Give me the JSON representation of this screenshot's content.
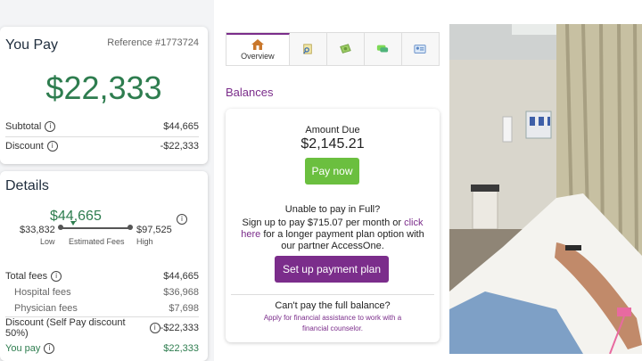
{
  "left": {
    "you_pay_title": "You Pay",
    "reference": "Reference #1773724",
    "amount": "$22,333",
    "subtotal_label": "Subtotal",
    "subtotal_value": "$44,665",
    "discount_label": "Discount",
    "discount_value": "-$22,333",
    "details_title": "Details",
    "estimate": {
      "center": "$44,665",
      "low_value": "$33,832",
      "high_value": "$97,525",
      "low_label": "Low",
      "mid_label": "Estimated Fees",
      "high_label": "High"
    },
    "fees": [
      {
        "label": "Total fees",
        "value": "$44,665"
      },
      {
        "label": "Hospital fees",
        "value": "$36,968"
      },
      {
        "label": "Physician fees",
        "value": "$7,698"
      },
      {
        "label": "Discount (Self Pay discount 50%)",
        "value": "-$22,333"
      },
      {
        "label": "You pay",
        "value": "$22,333"
      }
    ]
  },
  "tabs": [
    {
      "label": "Overview",
      "icon": "house-icon"
    },
    {
      "label": "",
      "icon": "document-icon"
    },
    {
      "label": "",
      "icon": "money-icon"
    },
    {
      "label": "",
      "icon": "chat-icon"
    },
    {
      "label": "",
      "icon": "id-card-icon"
    }
  ],
  "balances": {
    "heading": "Balances",
    "amount_due_label": "Amount Due",
    "amount_due_value": "$2,145.21",
    "pay_now": "Pay now",
    "unable": "Unable to pay in Full?",
    "signup_pre": "Sign up to pay $715.07 per month or ",
    "signup_link": "click here",
    "signup_post": " for a longer payment plan option with our partner AccessOne.",
    "setup_button": "Set up payment plan",
    "cant_pay": "Can't pay the full balance?",
    "assist_link": "Apply for financial assistance to work with a financial counselor."
  },
  "colors": {
    "green": "#2e7d4f",
    "purple": "#7b2d8b",
    "pay_now_green": "#6bbf3f"
  }
}
